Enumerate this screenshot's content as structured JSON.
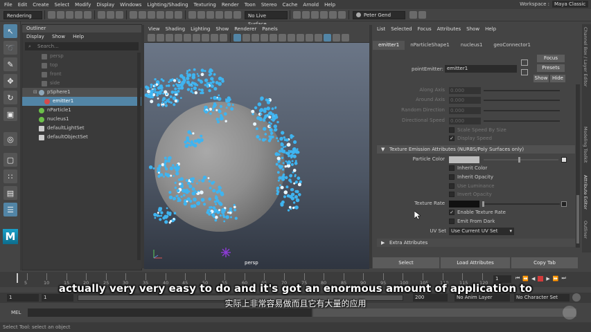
{
  "menubar": {
    "items": [
      "File",
      "Edit",
      "Create",
      "Select",
      "Modify",
      "Display",
      "Windows",
      "Lighting/Shading",
      "Texturing",
      "Render",
      "Toon",
      "Stereo",
      "Cache",
      "Arnold",
      "Help"
    ],
    "workspace_label": "Workspace :",
    "workspace_value": "Maya Classic"
  },
  "statusline": {
    "menuset": "Rendering",
    "live_surface": "No Live Surface",
    "user": "Peter Gend"
  },
  "outliner": {
    "title": "Outliner",
    "menu": [
      "Display",
      "Show",
      "Help"
    ],
    "search_placeholder": "Search...",
    "items": [
      "persp",
      "top",
      "front",
      "side",
      "pSphere1",
      "emitter1",
      "nParticle1",
      "nucleus1",
      "defaultLightSet",
      "defaultObjectSet"
    ]
  },
  "viewport": {
    "menu": [
      "View",
      "Shading",
      "Lighting",
      "Show",
      "Renderer",
      "Panels"
    ],
    "camera_label": "persp"
  },
  "attribute_editor": {
    "menu": [
      "List",
      "Selected",
      "Focus",
      "Attributes",
      "Show",
      "Help"
    ],
    "tabs": [
      "emitter1",
      "nParticleShape1",
      "nucleus1",
      "geoConnector1"
    ],
    "node_label": "pointEmitter:",
    "node_value": "emitter1",
    "focus_label": "Focus",
    "presets_label": "Presets",
    "show_label": "Show",
    "hide_label": "Hide",
    "rows": {
      "along_axis": "Along Axis",
      "around_axis": "Around Axis",
      "random_direction": "Random Direction",
      "directional_speed": "Directional Speed",
      "zero": "0.000",
      "scale_speed_by_size": "Scale Speed By Size",
      "display_speed": "Display Speed"
    },
    "section_texture": "Texture Emission Attributes (NURBS/Poly Surfaces only)",
    "particle_color": "Particle Color",
    "inherit_color": "Inherit Color",
    "inherit_opacity": "Inherit Opacity",
    "use_luminance": "Use Luminance",
    "invert_opacity": "Invert Opacity",
    "texture_rate": "Texture Rate",
    "enable_texture_rate": "Enable Texture Rate",
    "emit_from_dark": "Emit From Dark",
    "uv_set_label": "UV Set",
    "uv_set_value": "Use Current UV Set",
    "section_extra": "Extra Attributes",
    "footer": [
      "Select",
      "Load Attributes",
      "Copy Tab"
    ]
  },
  "sidetabs": [
    "Channel Box / Layer Editor",
    "Modeling Toolkit",
    "Attribute Editor",
    "Outliner"
  ],
  "timeslider": {
    "ticks": [
      "5",
      "10",
      "15",
      "20",
      "25",
      "30",
      "35",
      "40",
      "45",
      "50",
      "55",
      "60",
      "65",
      "70",
      "75",
      "80",
      "85",
      "90",
      "95",
      "100",
      "105",
      "110",
      "115",
      "120"
    ],
    "current_frame": "1"
  },
  "rangeslider": {
    "start": "1",
    "start2": "1",
    "end": "200",
    "anim_layer": "No Anim Layer",
    "character_set": "No Character Set"
  },
  "cmdline": {
    "label": "MEL"
  },
  "helpline": {
    "text": "Select Tool: select an object"
  },
  "subtitles": {
    "en": "actually very very easy to do and it's got an enormous amount of application to",
    "zh": "实际上非常容易做而且它有大量的应用"
  },
  "colors": {
    "selection": "#5285a6",
    "particles": "#3fb4f0",
    "accent_red": "#d23b3b"
  }
}
